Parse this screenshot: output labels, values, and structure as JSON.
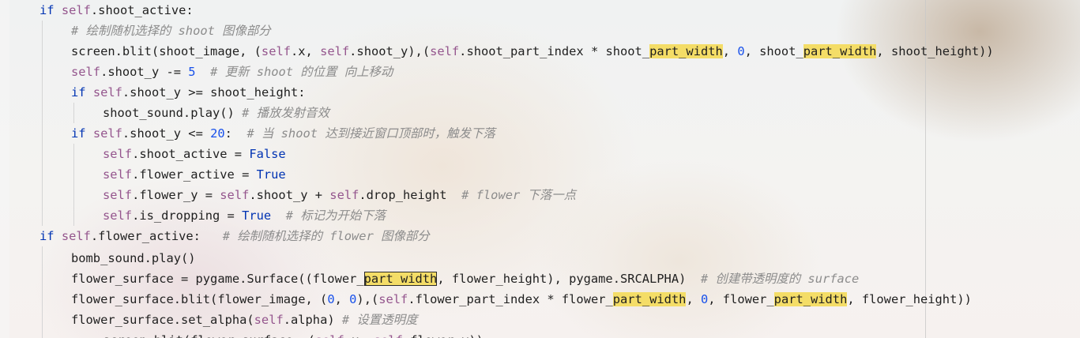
{
  "code_lines": [
    [
      {
        "t": "if",
        "k": "kw"
      },
      {
        "t": " "
      },
      {
        "t": "self",
        "k": "sf"
      },
      {
        "t": ".shoot_active:"
      }
    ],
    [
      {
        "t": "# 绘制随机选择的 shoot 图像部分",
        "k": "cm"
      }
    ],
    [
      {
        "t": "screen.blit(shoot_image, ("
      },
      {
        "t": "self",
        "k": "sf"
      },
      {
        "t": ".x, "
      },
      {
        "t": "self",
        "k": "sf"
      },
      {
        "t": ".shoot_y),("
      },
      {
        "t": "self",
        "k": "sf"
      },
      {
        "t": ".shoot_part_index * shoot_"
      },
      {
        "t": "part_width",
        "k": "hl"
      },
      {
        "t": ", "
      },
      {
        "t": "0",
        "k": "num"
      },
      {
        "t": ", shoot_"
      },
      {
        "t": "part_width",
        "k": "hl"
      },
      {
        "t": ", shoot_height))"
      }
    ],
    [
      {
        "t": "self",
        "k": "sf"
      },
      {
        "t": ".shoot_y -= "
      },
      {
        "t": "5",
        "k": "num"
      },
      {
        "t": "  "
      },
      {
        "t": "# 更新 shoot 的位置 向上移动",
        "k": "cm"
      }
    ],
    [
      {
        "t": "if",
        "k": "kw"
      },
      {
        "t": " "
      },
      {
        "t": "self",
        "k": "sf"
      },
      {
        "t": ".shoot_y >= shoot_height:"
      }
    ],
    [
      {
        "t": "shoot_sound.play() "
      },
      {
        "t": "# 播放发射音效",
        "k": "cm"
      }
    ],
    [
      {
        "t": "if",
        "k": "kw"
      },
      {
        "t": " "
      },
      {
        "t": "self",
        "k": "sf"
      },
      {
        "t": ".shoot_y <= "
      },
      {
        "t": "20",
        "k": "num"
      },
      {
        "t": ":  "
      },
      {
        "t": "# 当 shoot 达到接近窗口顶部时，触发下落",
        "k": "cm"
      }
    ],
    [
      {
        "t": "self",
        "k": "sf"
      },
      {
        "t": ".shoot_active = "
      },
      {
        "t": "False",
        "k": "kw"
      }
    ],
    [
      {
        "t": "self",
        "k": "sf"
      },
      {
        "t": ".flower_active = "
      },
      {
        "t": "True",
        "k": "kw"
      }
    ],
    [
      {
        "t": "self",
        "k": "sf"
      },
      {
        "t": ".flower_y = "
      },
      {
        "t": "self",
        "k": "sf"
      },
      {
        "t": ".shoot_y + "
      },
      {
        "t": "self",
        "k": "sf"
      },
      {
        "t": ".drop_height  "
      },
      {
        "t": "# flower 下落一点",
        "k": "cm"
      }
    ],
    [
      {
        "t": "self",
        "k": "sf"
      },
      {
        "t": ".is_dropping = "
      },
      {
        "t": "True",
        "k": "kw"
      },
      {
        "t": "  "
      },
      {
        "t": "# 标记为开始下落",
        "k": "cm"
      }
    ],
    [
      {
        "t": "if",
        "k": "kw"
      },
      {
        "t": " "
      },
      {
        "t": "self",
        "k": "sf"
      },
      {
        "t": ".flower_active:   "
      },
      {
        "t": "# 绘制随机选择的 flower 图像部分",
        "k": "cm"
      }
    ],
    [
      {
        "t": "bomb_sound.play()"
      }
    ],
    [
      {
        "t": "flower_surface = pygame.Surface((flower_"
      },
      {
        "t": "part_width",
        "k": "hl-box"
      },
      {
        "t": ", flower_height), pygame.SRCALPHA)  "
      },
      {
        "t": "# 创建带透明度的 surface",
        "k": "cm"
      }
    ],
    [
      {
        "t": "flower_surface.blit(flower_image, ("
      },
      {
        "t": "0",
        "k": "num"
      },
      {
        "t": ", "
      },
      {
        "t": "0",
        "k": "num"
      },
      {
        "t": "),("
      },
      {
        "t": "self",
        "k": "sf"
      },
      {
        "t": ".flower_part_index * flower_"
      },
      {
        "t": "part_width",
        "k": "hl"
      },
      {
        "t": ", "
      },
      {
        "t": "0",
        "k": "num"
      },
      {
        "t": ", flower_"
      },
      {
        "t": "part_width",
        "k": "hl"
      },
      {
        "t": ", flower_height))"
      }
    ],
    [
      {
        "t": "flower_surface.set_alpha("
      },
      {
        "t": "self",
        "k": "sf"
      },
      {
        "t": ".alpha) "
      },
      {
        "t": "# 设置透明度",
        "k": "cm"
      }
    ],
    [
      {
        "t": "screen.blit(flower_surface, ("
      },
      {
        "t": "self",
        "k": "sf"
      },
      {
        "t": ".x, "
      },
      {
        "t": "self",
        "k": "sf"
      },
      {
        "t": ".flower_y))"
      }
    ]
  ]
}
